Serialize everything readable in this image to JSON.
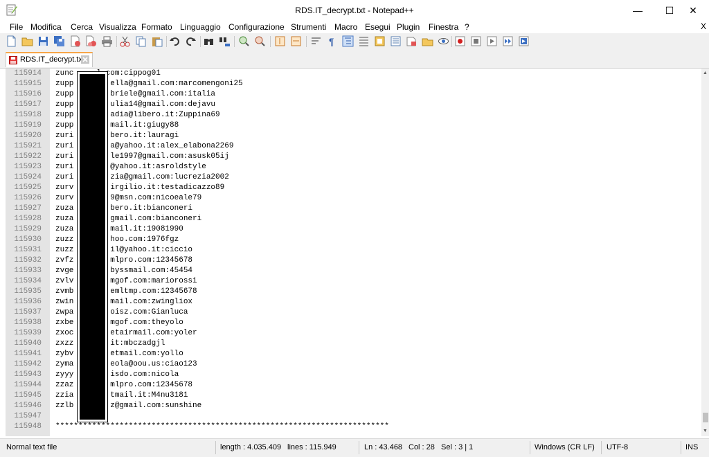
{
  "window": {
    "title": "RDS.IT_decrypt.txt - Notepad++",
    "minimize_glyph": "—",
    "maximize_glyph": "☐",
    "close_glyph": "✕"
  },
  "menu": {
    "items": [
      "File",
      "Modifica",
      "Cerca",
      "Visualizza",
      "Formato",
      "Linguaggio",
      "Configurazione",
      "Strumenti",
      "Macro",
      "Esegui",
      "Plugin",
      "Finestra",
      "?"
    ],
    "close_glyph": "X"
  },
  "toolbar": {
    "buttons": [
      "new-file-icon",
      "open-file-icon",
      "save-icon",
      "save-all-icon",
      "close-icon",
      "close-all-icon",
      "print-icon",
      "cut-icon",
      "copy-icon",
      "paste-icon",
      "undo-icon",
      "redo-icon",
      "find-icon",
      "replace-icon",
      "zoom-in-icon",
      "zoom-out-icon",
      "sync-vertical-icon",
      "sync-horizontal-icon",
      "word-wrap-icon",
      "show-all-chars-icon",
      "indent-guide-icon",
      "udl-icon",
      "doc-map-icon",
      "function-list-icon",
      "folder-workspace-icon",
      "monitoring-icon",
      "record-macro-icon",
      "stop-record-icon",
      "play-macro-icon",
      "run-macro-multiple-icon",
      "save-macro-icon"
    ]
  },
  "tab": {
    "label": "RDS.IT_decrypt.txt"
  },
  "editor": {
    "lines": [
      {
        "num": "115914",
        "text": "zunc     l.com:cippog01"
      },
      {
        "num": "115915",
        "text": "zupp        ella@gmail.com:marcomengoni25"
      },
      {
        "num": "115916",
        "text": "zupp        briele@gmail.com:italia"
      },
      {
        "num": "115917",
        "text": "zupp        ulia14@gmail.com:dejavu"
      },
      {
        "num": "115918",
        "text": "zupp        adia@libero.it:Zuppina69"
      },
      {
        "num": "115919",
        "text": "zupp        mail.it:giugy88"
      },
      {
        "num": "115920",
        "text": "zuri        bero.it:lauragi"
      },
      {
        "num": "115921",
        "text": "zuri        a@yahoo.it:alex_elabona2269"
      },
      {
        "num": "115922",
        "text": "zuri        le1997@gmail.com:asusk05ij"
      },
      {
        "num": "115923",
        "text": "zuri        @yahoo.it:asroldstyle"
      },
      {
        "num": "115924",
        "text": "zuri        zia@gmail.com:lucrezia2002"
      },
      {
        "num": "115925",
        "text": "zurv        irgilio.it:testadicazzo89"
      },
      {
        "num": "115926",
        "text": "zurv        9@msn.com:nicoeale79"
      },
      {
        "num": "115927",
        "text": "zuza        bero.it:bianconeri"
      },
      {
        "num": "115928",
        "text": "zuza        gmail.com:bianconeri"
      },
      {
        "num": "115929",
        "text": "zuza        mail.it:19081990"
      },
      {
        "num": "115930",
        "text": "zuzz        hoo.com:1976fgz"
      },
      {
        "num": "115931",
        "text": "zuzz        il@yahoo.it:ciccio"
      },
      {
        "num": "115932",
        "text": "zvfz        mlpro.com:12345678"
      },
      {
        "num": "115933",
        "text": "zvge        byssmail.com:45454"
      },
      {
        "num": "115934",
        "text": "zvlv        mgof.com:mariorossi"
      },
      {
        "num": "115935",
        "text": "zvmb        emltmp.com:12345678"
      },
      {
        "num": "115936",
        "text": "zwin        mail.com:zwingliox"
      },
      {
        "num": "115937",
        "text": "zwpa        oisz.com:Gianluca"
      },
      {
        "num": "115938",
        "text": "zxbe        mgof.com:theyolo"
      },
      {
        "num": "115939",
        "text": "zxoc        etairmail.com:yoler"
      },
      {
        "num": "115940",
        "text": "zxzz        it:mbczadgjl"
      },
      {
        "num": "115941",
        "text": "zybv        etmail.com:yollo"
      },
      {
        "num": "115942",
        "text": "zyma        eola@oou.us:ciao123"
      },
      {
        "num": "115943",
        "text": "zyyy        isdo.com:nicola"
      },
      {
        "num": "115944",
        "text": "zzaz        mlpro.com:12345678"
      },
      {
        "num": "115945",
        "text": "zzia        tmail.it:M4nu3181"
      },
      {
        "num": "115946",
        "text": "zzlb        z@gmail.com:sunshine"
      },
      {
        "num": "115947",
        "text": ""
      },
      {
        "num": "115948",
        "text": "*************************************************************************"
      }
    ]
  },
  "scrollbar": {
    "up_glyph": "▲",
    "down_glyph": "▼"
  },
  "status": {
    "file_type": "Normal text file",
    "length": "length : 4.035.409",
    "lines": "lines : 115.949",
    "ln": "Ln : 43.468",
    "col": "Col : 28",
    "sel": "Sel : 3 | 1",
    "eol": "Windows (CR LF)",
    "encoding": "UTF-8",
    "mode": "INS"
  }
}
